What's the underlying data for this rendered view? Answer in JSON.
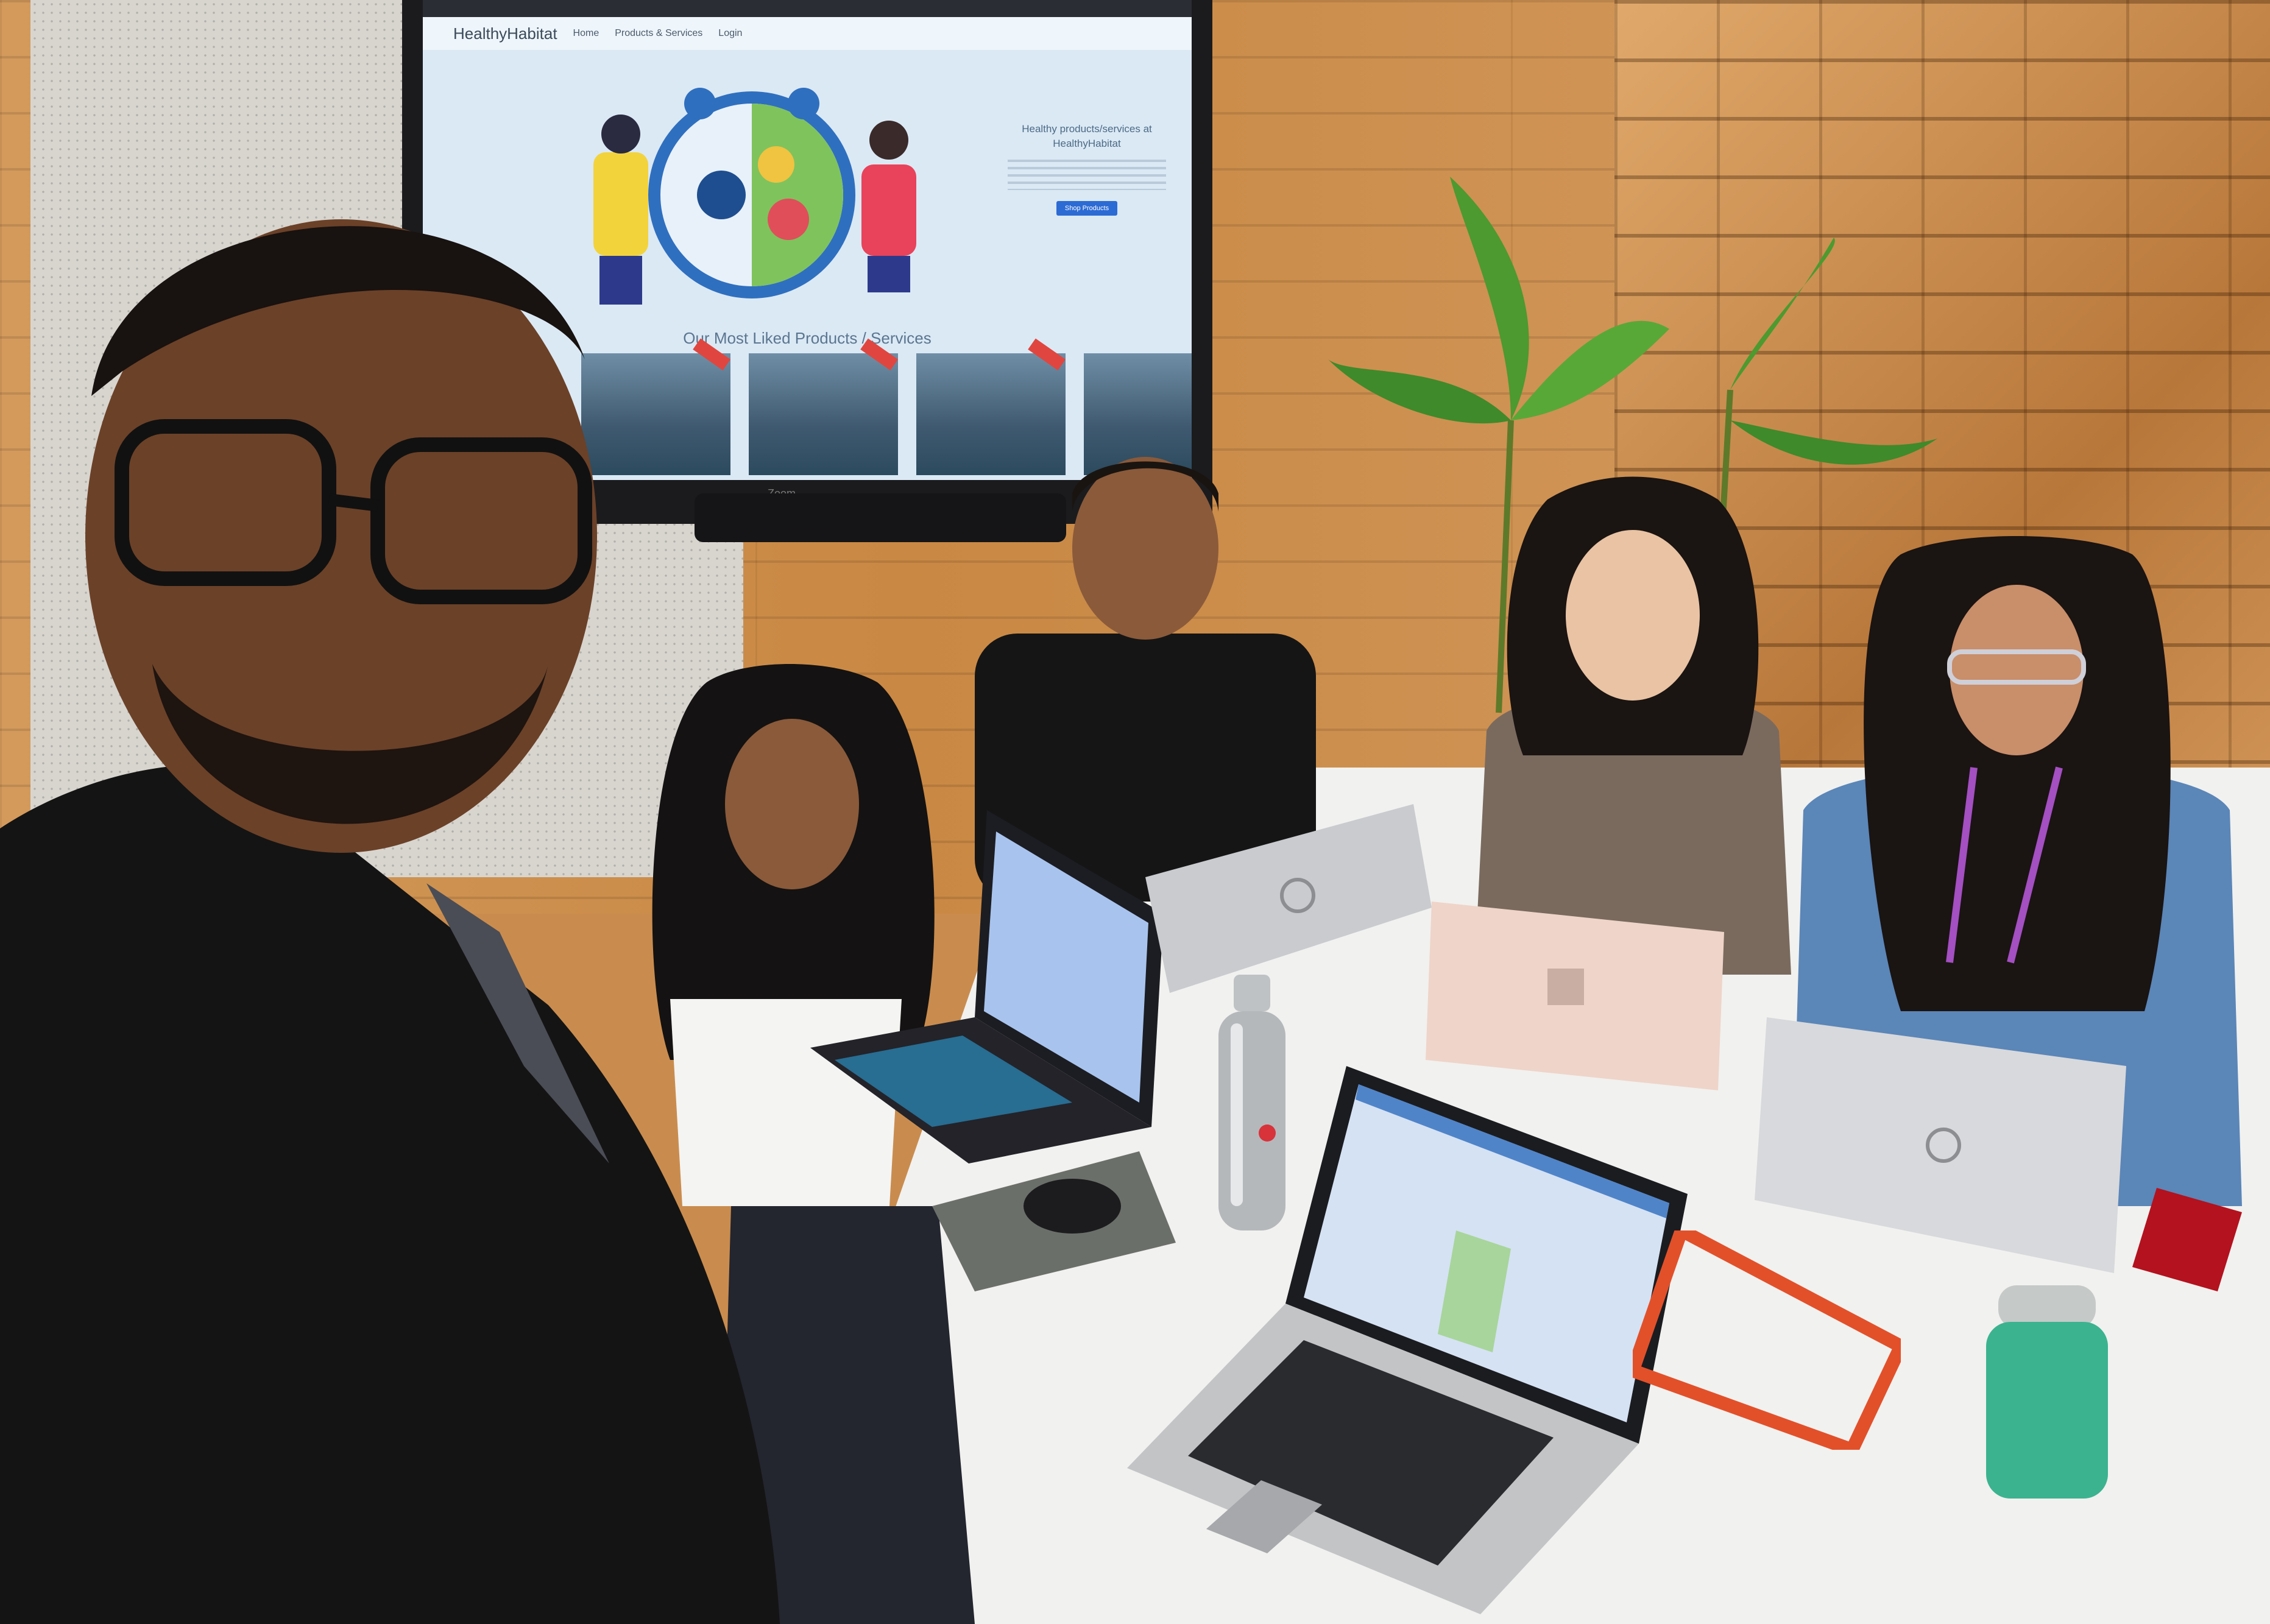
{
  "tv_screen": {
    "brand": "HealthyHabitat",
    "nav_links": [
      "Home",
      "Products & Services",
      "Login"
    ],
    "hero_heading": "Healthy products/services at HealthyHabitat",
    "hero_button": "Shop Products",
    "section_title": "Our Most Liked Products / Services",
    "tv_brand": "Zoom"
  },
  "colors": {
    "wood": "#c98843",
    "screen_bg": "#dbe9f5",
    "table": "#f1f1ef",
    "accent_blue": "#2c6bd4",
    "cable_tray": "#e2502a",
    "bottle_green": "#3bb38f"
  }
}
